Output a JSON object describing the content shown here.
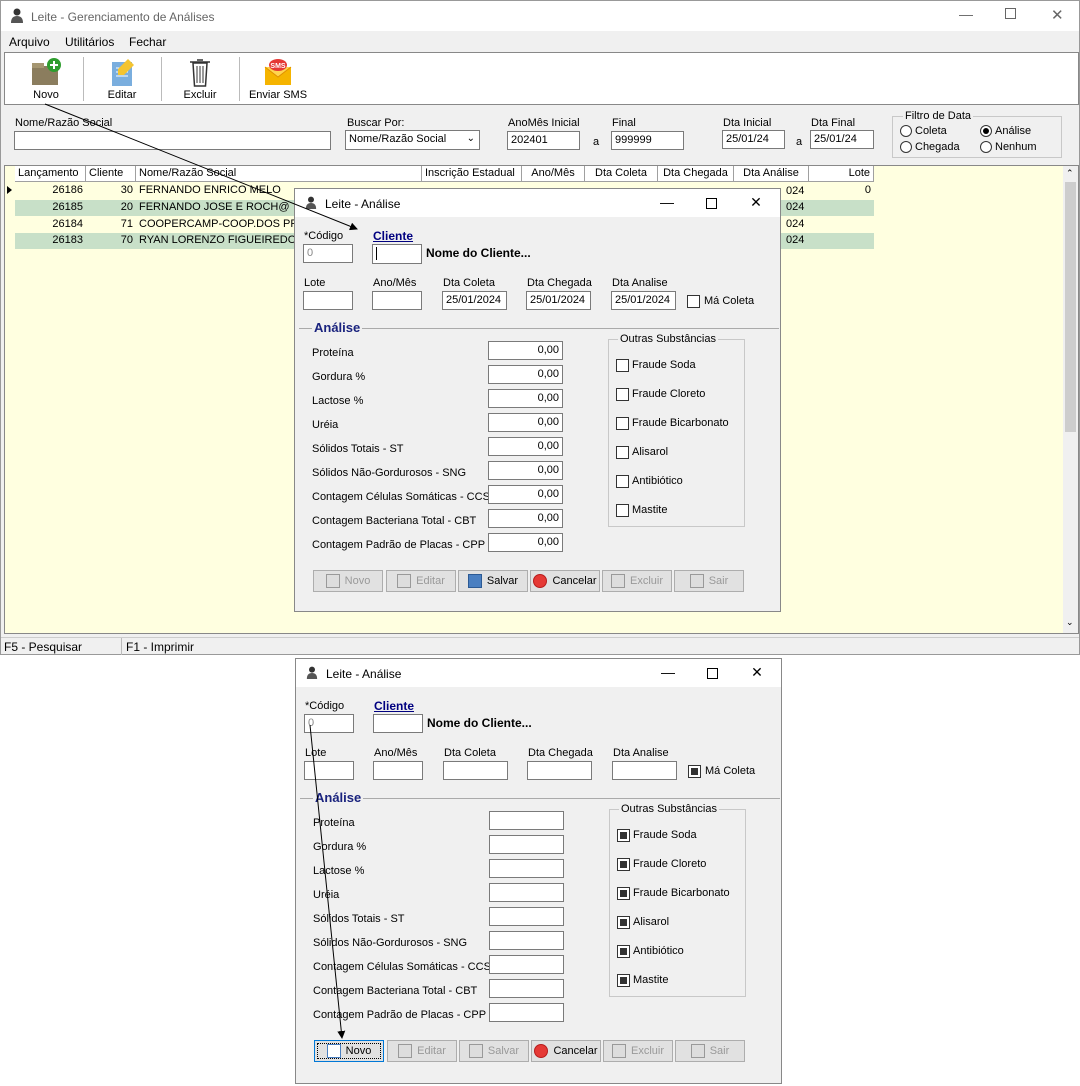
{
  "main_window": {
    "title": "Leite - Gerenciamento de Análises",
    "menu": [
      "Arquivo",
      "Utilitários",
      "Fechar"
    ],
    "toolbar": [
      {
        "label": "Novo",
        "icon": "folder-add-icon"
      },
      {
        "label": "Editar",
        "icon": "edit-document-icon"
      },
      {
        "label": "Excluir",
        "icon": "trash-icon"
      },
      {
        "label": "Enviar SMS",
        "icon": "sms-envelope-icon"
      }
    ],
    "filters": {
      "nome_label": "Nome/Razão Social",
      "nome_value": "",
      "buscar_label": "Buscar Por:",
      "buscar_value": "Nome/Razão Social",
      "anomes_label": "AnoMês Inicial",
      "anomes_value": "202401",
      "a1": "a",
      "final_label": "Final",
      "final_value": "999999",
      "dta_ini_label": "Dta Inicial",
      "dta_ini_value": "25/01/24",
      "a2": "a",
      "dta_fin_label": "Dta Final",
      "dta_fin_value": "25/01/24",
      "filtro_title": "Filtro de Data",
      "radio_coleta": "Coleta",
      "radio_analise": "Análise",
      "radio_chegada": "Chegada",
      "radio_nenhum": "Nenhum",
      "selected": "Análise"
    },
    "grid": {
      "columns": [
        "Lançamento",
        "Cliente",
        "Nome/Razão Social",
        "Inscrição Estadual",
        "Ano/Mês",
        "Dta Coleta",
        "Dta Chegada",
        "Dta Análise",
        "Lote"
      ],
      "rows": [
        {
          "lancamento": "26186",
          "cliente": "30",
          "nome": "FERNANDO ENRICO MELO",
          "lote": "0",
          "partial_date": "024"
        },
        {
          "lancamento": "26185",
          "cliente": "20",
          "nome": "FERNANDO JOSE E ROCH@",
          "lote": "",
          "partial_date": "024"
        },
        {
          "lancamento": "26184",
          "cliente": "71",
          "nome": "COOPERCAMP-COOP.DOS PRO",
          "lote": "",
          "partial_date": "024"
        },
        {
          "lancamento": "26183",
          "cliente": "70",
          "nome": "RYAN LORENZO FIGUEIREDO",
          "lote": "",
          "partial_date": "024"
        }
      ]
    },
    "status": [
      "F5 - Pesquisar",
      "F1 - Imprimir"
    ]
  },
  "dialog1": {
    "title": "Leite - Análise",
    "codigo_label": "*Código",
    "codigo_value": "0",
    "cliente_link": "Cliente",
    "cliente_value": "",
    "nome_cliente": "Nome do Cliente...",
    "lote_label": "Lote",
    "anomes_label": "Ano/Mês",
    "dta_coleta_label": "Dta Coleta",
    "dta_coleta_value": "25/01/2024",
    "dta_chegada_label": "Dta Chegada",
    "dta_chegada_value": "25/01/2024",
    "dta_analise_label": "Dta Analise",
    "dta_analise_value": "25/01/2024",
    "ma_coleta": "Má Coleta",
    "analise_title": "Análise",
    "fields": [
      {
        "label": "Proteína",
        "value": "0,00"
      },
      {
        "label": "Gordura %",
        "value": "0,00"
      },
      {
        "label": "Lactose %",
        "value": "0,00"
      },
      {
        "label": "Uréia",
        "value": "0,00"
      },
      {
        "label": "Sólidos Totais - ST",
        "value": "0,00"
      },
      {
        "label": "Sólidos Não-Gordurosos - SNG",
        "value": "0,00"
      },
      {
        "label": "Contagem Células Somáticas - CCS",
        "value": "0,00"
      },
      {
        "label": "Contagem Bacteriana Total - CBT",
        "value": "0,00"
      },
      {
        "label": "Contagem Padrão de Placas - CPP",
        "value": "0,00"
      }
    ],
    "outras_title": "Outras Substâncias",
    "outras": [
      {
        "label": "Fraude Soda",
        "checked": false
      },
      {
        "label": "Fraude Cloreto",
        "checked": false
      },
      {
        "label": "Fraude Bicarbonato",
        "checked": false
      },
      {
        "label": "Alisarol",
        "checked": false
      },
      {
        "label": "Antibiótico",
        "checked": false
      },
      {
        "label": "Mastite",
        "checked": false
      }
    ],
    "buttons": [
      {
        "label": "Novo",
        "enabled": false
      },
      {
        "label": "Editar",
        "enabled": false
      },
      {
        "label": "Salvar",
        "enabled": true
      },
      {
        "label": "Cancelar",
        "enabled": true
      },
      {
        "label": "Excluir",
        "enabled": false
      },
      {
        "label": "Sair",
        "enabled": false
      }
    ]
  },
  "dialog2": {
    "title": "Leite - Análise",
    "codigo_label": "*Código",
    "codigo_value": "0",
    "cliente_link": "Cliente",
    "nome_cliente": "Nome do Cliente...",
    "lote_label": "Lote",
    "anomes_label": "Ano/Mês",
    "dta_coleta_label": "Dta Coleta",
    "dta_chegada_label": "Dta Chegada",
    "dta_analise_label": "Dta Analise",
    "ma_coleta": "Má Coleta",
    "analise_title": "Análise",
    "fields": [
      "Proteína",
      "Gordura %",
      "Lactose %",
      "Uréia",
      "Sólidos Totais - ST",
      "Sólidos Não-Gordurosos - SNG",
      "Contagem Células Somáticas - CCS",
      "Contagem Bacteriana Total - CBT",
      "Contagem Padrão de Placas - CPP"
    ],
    "outras_title": "Outras Substâncias",
    "outras": [
      "Fraude Soda",
      "Fraude Cloreto",
      "Fraude Bicarbonato",
      "Alisarol",
      "Antibiótico",
      "Mastite"
    ],
    "buttons": [
      {
        "label": "Novo",
        "enabled": true
      },
      {
        "label": "Editar",
        "enabled": false
      },
      {
        "label": "Salvar",
        "enabled": false
      },
      {
        "label": "Cancelar",
        "enabled": true
      },
      {
        "label": "Excluir",
        "enabled": false
      },
      {
        "label": "Sair",
        "enabled": false
      }
    ]
  }
}
